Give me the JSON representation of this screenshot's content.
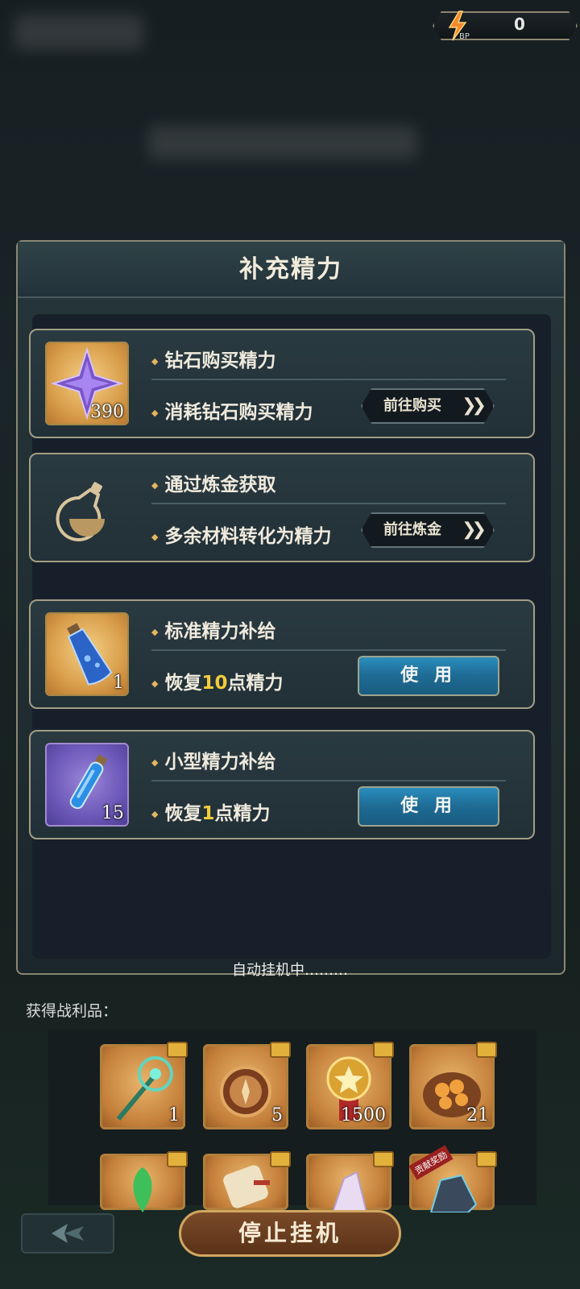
{
  "bp": {
    "label": "BP",
    "value": "0"
  },
  "panel": {
    "title": "补充精力"
  },
  "cards": [
    {
      "title": "钻石购买精力",
      "desc": "消耗钻石购买精力",
      "count": "390",
      "button": "前往购买",
      "button_type": "goto",
      "icon": "diamond-star-icon"
    },
    {
      "title": "通过炼金获取",
      "desc": "多余材料转化为精力",
      "count": "",
      "button": "前往炼金",
      "button_type": "goto",
      "icon": "alchemy-flask-icon"
    },
    {
      "title": "标准精力补给",
      "desc_prefix": "恢复",
      "desc_hl": "10",
      "desc_suffix": "点精力",
      "count": "1",
      "button": "使 用",
      "button_type": "use",
      "icon": "blue-potion-icon"
    },
    {
      "title": "小型精力补给",
      "desc_prefix": "恢复",
      "desc_hl": "1",
      "desc_suffix": "点精力",
      "count": "15",
      "button": "使 用",
      "button_type": "use",
      "icon": "small-potion-icon"
    }
  ],
  "auto_status": "自动挂机中………",
  "loot": {
    "label": "获得战利品：",
    "items": [
      {
        "icon": "staff-icon",
        "qty": "1"
      },
      {
        "icon": "compass-icon",
        "qty": "5"
      },
      {
        "icon": "medal-icon",
        "qty": "1500"
      },
      {
        "icon": "food-basket-icon",
        "qty": "21"
      },
      {
        "icon": "herb-icon",
        "qty": ""
      },
      {
        "icon": "scroll-icon",
        "qty": ""
      },
      {
        "icon": "crystal-icon",
        "qty": ""
      },
      {
        "icon": "ore-icon",
        "qty": ""
      }
    ],
    "badge": "贡献奖励"
  },
  "stop_button": "停止挂机",
  "colors": {
    "accent_gold": "#e4b660",
    "use_blue": "#2a8dbd",
    "highlight": "#f2cc3c"
  }
}
